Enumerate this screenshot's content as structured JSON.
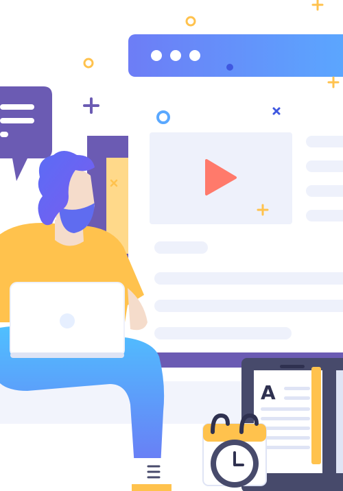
{
  "illustration": {
    "description_visible_text": {
      "document_letter": "A"
    },
    "icons": [
      "browser-window-dots-icon",
      "play-icon",
      "chat-bubble-icon",
      "laptop-icon",
      "calendar-clock-icon",
      "document-icon",
      "plus-sparkle-icon",
      "cross-sparkle-icon",
      "ring-sparkle-icon"
    ],
    "colors": {
      "accent_blue": "#5b8cff",
      "accent_purple": "#6b5bb3",
      "play_red": "#ff7a6b",
      "shirt_yellow": "#ffc24d",
      "pants_blue": "#5ab4ff",
      "placeholder_gray": "#eef1fb",
      "dark_slate": "#474a6b"
    }
  }
}
